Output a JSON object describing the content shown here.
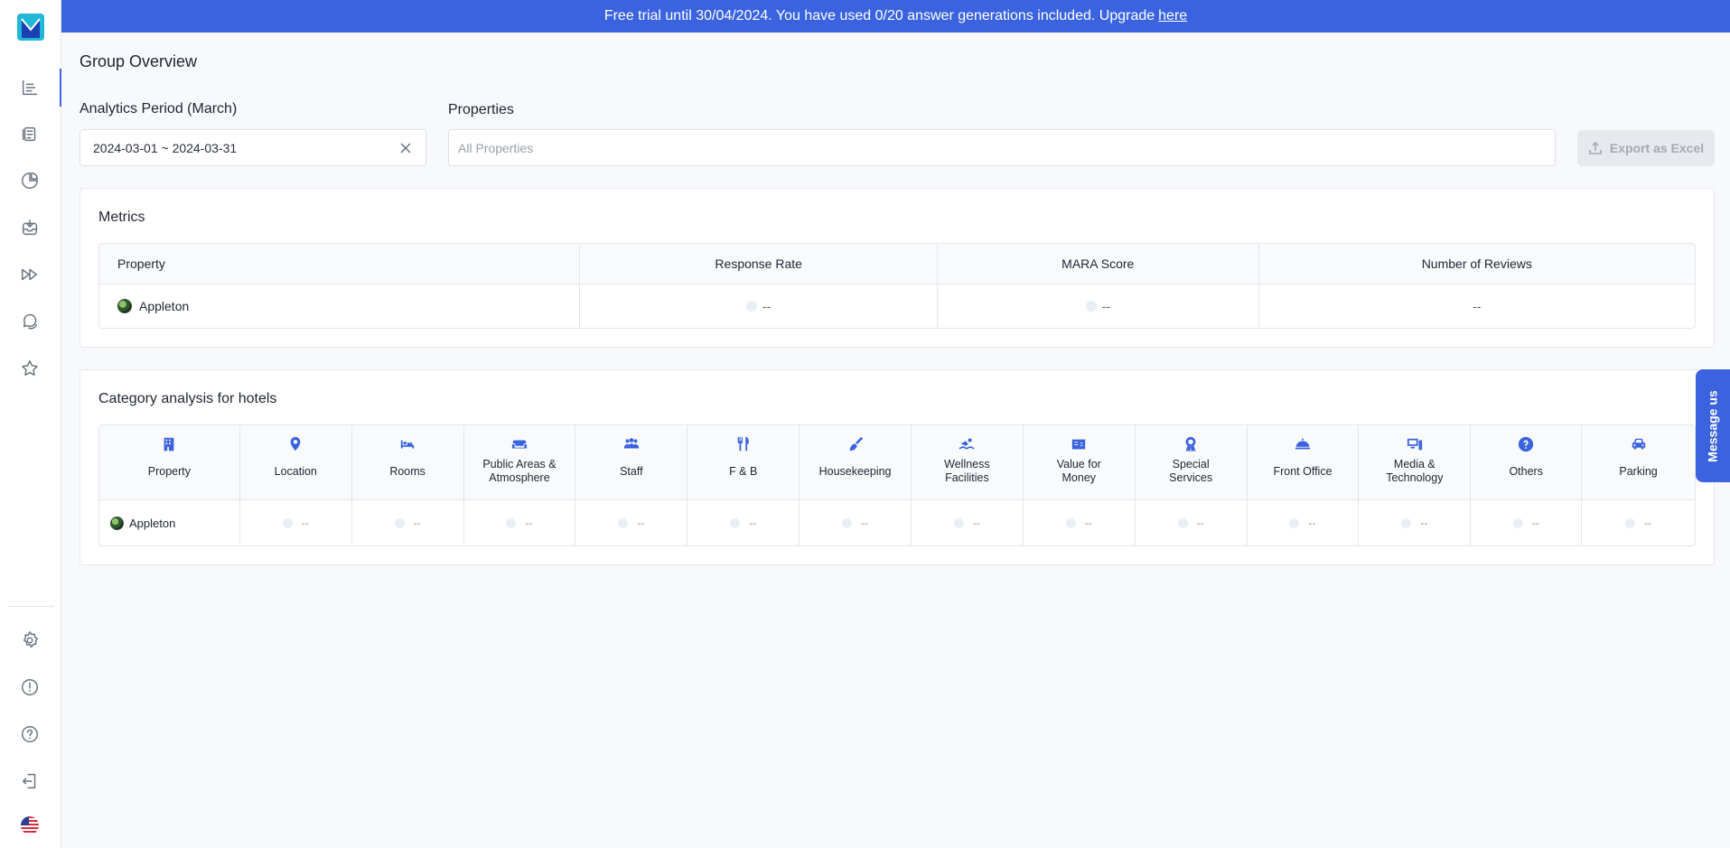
{
  "banner": {
    "text": "Free trial until 30/04/2024. You have used 0/20 answer generations included. Upgrade",
    "link": "here"
  },
  "page": {
    "title": "Group Overview"
  },
  "filters": {
    "period_label": "Analytics Period (March)",
    "period_value": "2024-03-01 ~ 2024-03-31",
    "properties_label": "Properties",
    "properties_placeholder": "All Properties",
    "export_label": "Export as Excel"
  },
  "metrics": {
    "title": "Metrics",
    "columns": [
      "Property",
      "Response Rate",
      "MARA Score",
      "Number of Reviews"
    ],
    "rows": [
      {
        "property": "Appleton",
        "response_rate": "--",
        "mara_score": "--",
        "reviews": "--"
      }
    ]
  },
  "categories": {
    "title": "Category analysis for hotels",
    "columns": [
      {
        "label": "Property",
        "icon": "building-icon"
      },
      {
        "label": "Location",
        "icon": "location-pin-icon"
      },
      {
        "label": "Rooms",
        "icon": "bed-icon"
      },
      {
        "label": "Public Areas & Atmosphere",
        "icon": "sofa-icon"
      },
      {
        "label": "Staff",
        "icon": "people-icon"
      },
      {
        "label": "F & B",
        "icon": "utensils-icon"
      },
      {
        "label": "Housekeeping",
        "icon": "broom-icon"
      },
      {
        "label": "Wellness Facilities",
        "icon": "swimmer-icon"
      },
      {
        "label": "Value for Money",
        "icon": "money-icon"
      },
      {
        "label": "Special Services",
        "icon": "award-icon"
      },
      {
        "label": "Front Office",
        "icon": "bell-icon"
      },
      {
        "label": "Media & Technology",
        "icon": "devices-icon"
      },
      {
        "label": "Others",
        "icon": "question-icon"
      },
      {
        "label": "Parking",
        "icon": "car-icon"
      }
    ],
    "rows": [
      {
        "property": "Appleton",
        "values": [
          "--",
          "--",
          "--",
          "--",
          "--",
          "--",
          "--",
          "--",
          "--",
          "--",
          "--",
          "--",
          "--"
        ]
      }
    ]
  },
  "message_us": "Message us",
  "colors": {
    "accent": "#3b63e0",
    "banner": "#3b63e0"
  }
}
